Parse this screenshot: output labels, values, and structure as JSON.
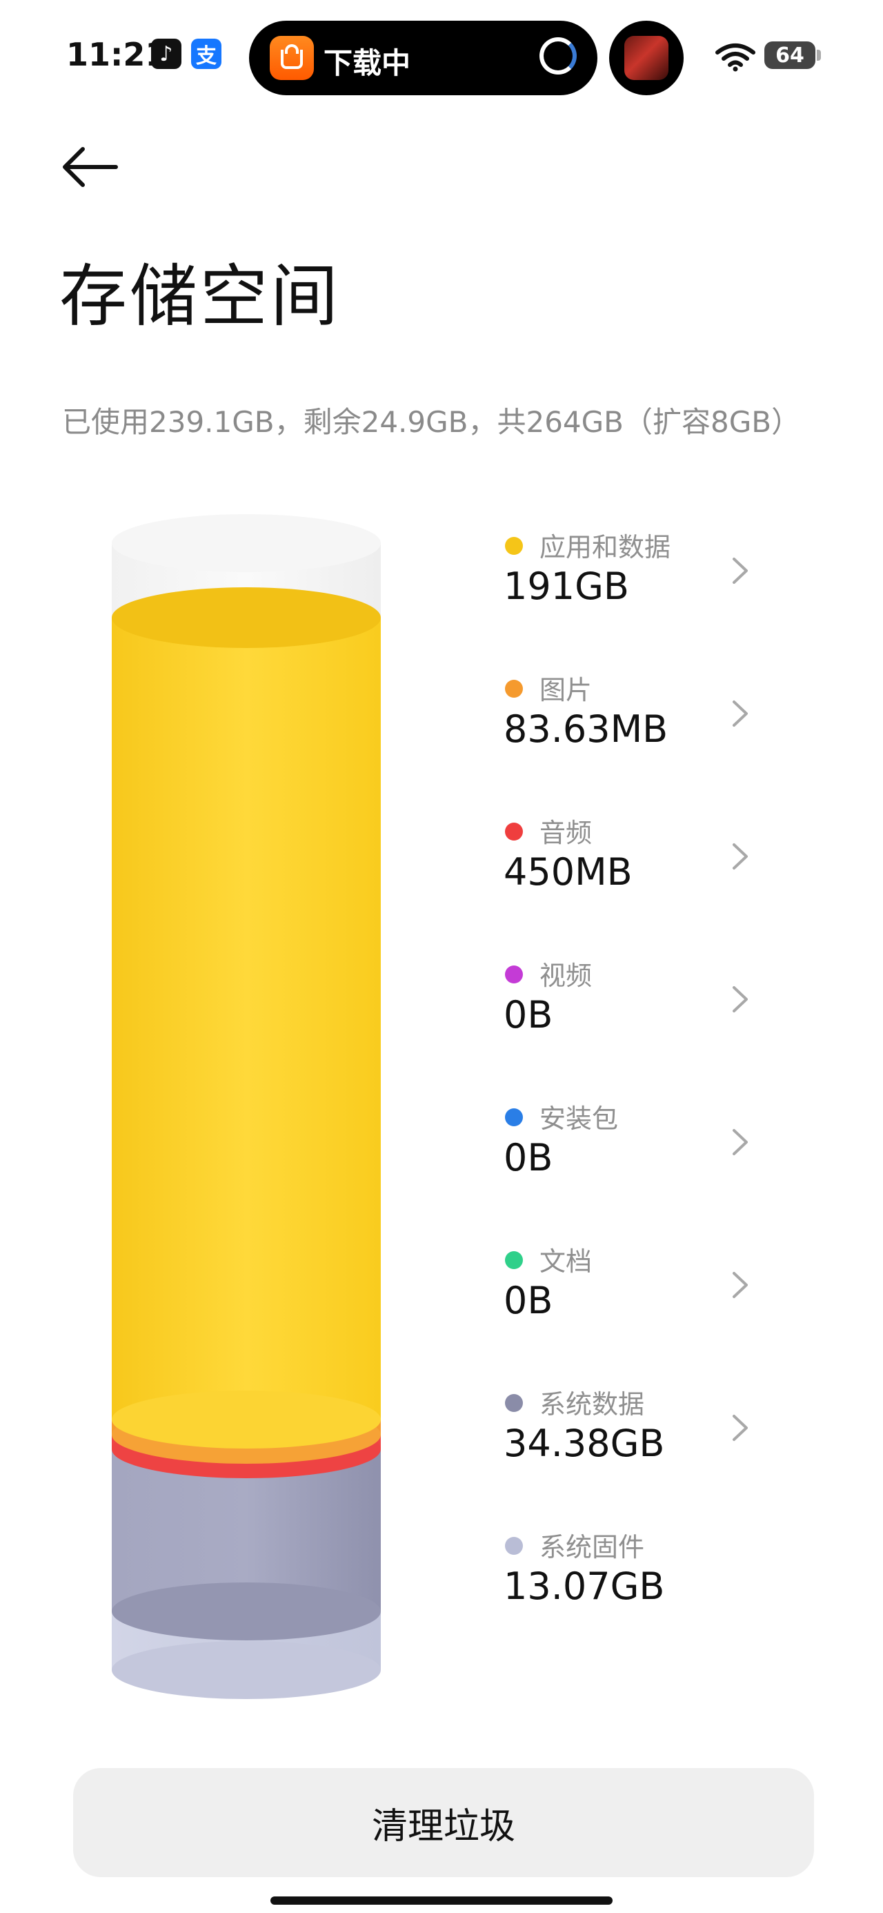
{
  "status_bar": {
    "time": "11:21",
    "apps": [
      {
        "name": "tiktok-icon",
        "glyph": "♪"
      },
      {
        "name": "alipay-icon",
        "glyph": "支"
      }
    ],
    "island": {
      "app_icon": "xiaomi-app-store-icon",
      "label": "下载中"
    },
    "battery": "64"
  },
  "header": {
    "title": "存储空间"
  },
  "summary": "已使用239.1GB，剩余24.9GB，共264GB（扩容8GB）",
  "categories": [
    {
      "label": "应用和数据",
      "size": "191GB",
      "color": "#f5c518",
      "chevron": true
    },
    {
      "label": "图片",
      "size": "83.63MB",
      "color": "#f59a2e",
      "chevron": true
    },
    {
      "label": "音频",
      "size": "450MB",
      "color": "#ef3e3e",
      "chevron": true
    },
    {
      "label": "视频",
      "size": "0B",
      "color": "#c43bd6",
      "chevron": true
    },
    {
      "label": "安装包",
      "size": "0B",
      "color": "#2a7ee6",
      "chevron": true
    },
    {
      "label": "文档",
      "size": "0B",
      "color": "#2fd08a",
      "chevron": true
    },
    {
      "label": "系统数据",
      "size": "34.38GB",
      "color": "#8a8ca8",
      "chevron": true
    },
    {
      "label": "系统固件",
      "size": "13.07GB",
      "color": "#b9bdd6",
      "chevron": false
    }
  ],
  "actions": {
    "clean_label": "清理垃圾"
  },
  "colors": {
    "apps": "#f5c518",
    "images": "#f59a2e",
    "audio": "#ef3e3e",
    "system_data": "#9c9eb8",
    "firmware": "#c9ccdf",
    "free": "#f2f2f2"
  }
}
